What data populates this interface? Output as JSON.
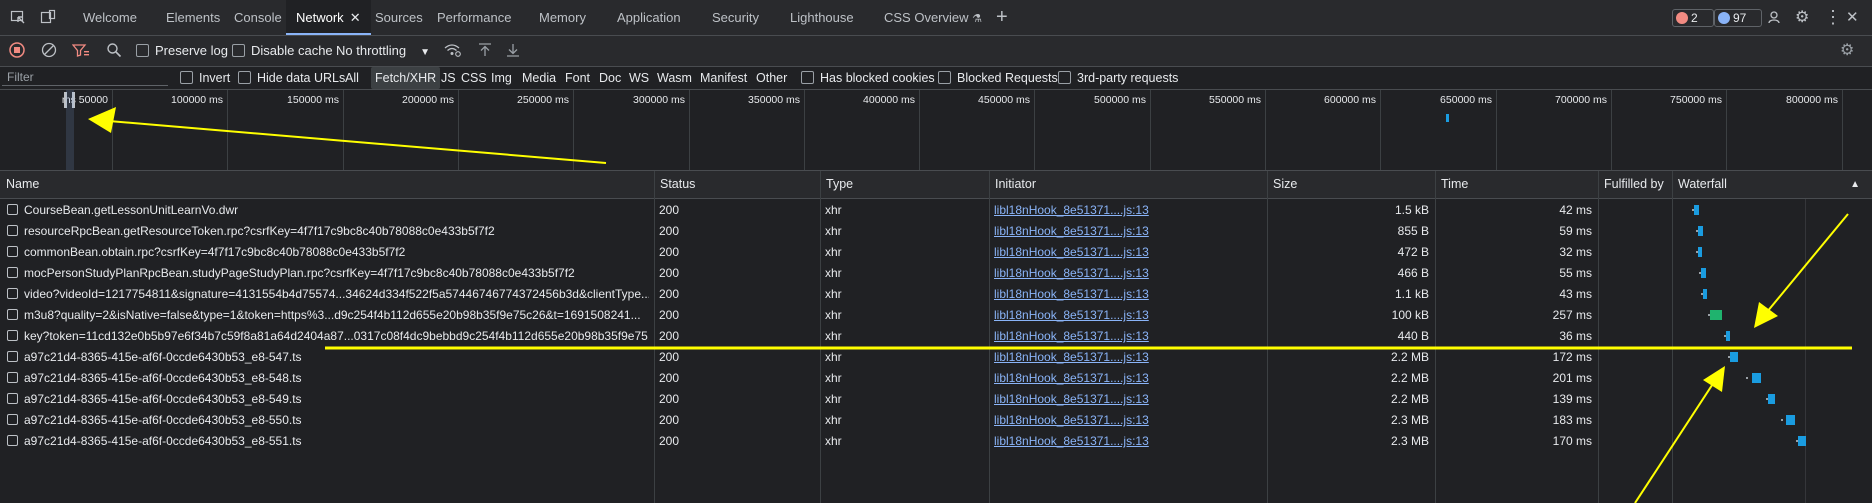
{
  "tabs": {
    "welcome": "Welcome",
    "elements": "Elements",
    "console": "Console",
    "network": "Network",
    "sources": "Sources",
    "performance": "Performance",
    "memory": "Memory",
    "application": "Application",
    "security": "Security",
    "lighthouse": "Lighthouse",
    "css_overview": "CSS Overview"
  },
  "status_counts": {
    "errors": "2",
    "messages": "97"
  },
  "toolbar": {
    "preserve_log": "Preserve log",
    "disable_cache": "Disable cache",
    "throttling": "No throttling"
  },
  "filter": {
    "placeholder": "Filter",
    "invert": "Invert",
    "hide_data_urls": "Hide data URLs",
    "types": [
      "All",
      "Fetch/XHR",
      "JS",
      "CSS",
      "Img",
      "Media",
      "Font",
      "Doc",
      "WS",
      "Wasm",
      "Manifest",
      "Other"
    ],
    "selected_type": "Fetch/XHR",
    "has_blocked_cookies": "Has blocked cookies",
    "blocked_requests": "Blocked Requests",
    "third_party": "3rd-party requests"
  },
  "overview_ticks": [
    "50000 ms",
    "100000 ms",
    "150000 ms",
    "200000 ms",
    "250000 ms",
    "300000 ms",
    "350000 ms",
    "400000 ms",
    "450000 ms",
    "500000 ms",
    "550000 ms",
    "600000 ms",
    "650000 ms",
    "700000 ms",
    "750000 ms",
    "800000 ms"
  ],
  "columns": {
    "name": "Name",
    "status": "Status",
    "type": "Type",
    "initiator": "Initiator",
    "size": "Size",
    "time": "Time",
    "fulfilled_by": "Fulfilled by",
    "waterfall": "Waterfall"
  },
  "requests": [
    {
      "name": "CourseBean.getLessonUnitLearnVo.dwr",
      "status": "200",
      "type": "xhr",
      "initiator": "libl18nHook_8e51371....js:13",
      "size": "1.5 kB",
      "time": "42 ms"
    },
    {
      "name": "resourceRpcBean.getResourceToken.rpc?csrfKey=4f7f17c9bc8c40b78088c0e433b5f7f2",
      "status": "200",
      "type": "xhr",
      "initiator": "libl18nHook_8e51371....js:13",
      "size": "855 B",
      "time": "59 ms"
    },
    {
      "name": "commonBean.obtain.rpc?csrfKey=4f7f17c9bc8c40b78088c0e433b5f7f2",
      "status": "200",
      "type": "xhr",
      "initiator": "libl18nHook_8e51371....js:13",
      "size": "472 B",
      "time": "32 ms"
    },
    {
      "name": "mocPersonStudyPlanRpcBean.studyPageStudyPlan.rpc?csrfKey=4f7f17c9bc8c40b78088c0e433b5f7f2",
      "status": "200",
      "type": "xhr",
      "initiator": "libl18nHook_8e51371....js:13",
      "size": "466 B",
      "time": "55 ms"
    },
    {
      "name": "video?videoId=1217754811&signature=4131554b4d75574...34624d334f522f5a57446746774372456b3d&clientType...",
      "status": "200",
      "type": "xhr",
      "initiator": "libl18nHook_8e51371....js:13",
      "size": "1.1 kB",
      "time": "43 ms"
    },
    {
      "name": "m3u8?quality=2&isNative=false&type=1&token=https%3...d9c254f4b112d655e20b98b35f9e75c26&t=1691508241...",
      "status": "200",
      "type": "xhr",
      "initiator": "libl18nHook_8e51371....js:13",
      "size": "100 kB",
      "time": "257 ms"
    },
    {
      "name": "key?token=11cd132e0b5b97e6f34b7c59f8a81a64d2404a87...0317c08f4dc9bebbd9c254f4b112d655e20b98b35f9e75...",
      "status": "200",
      "type": "xhr",
      "initiator": "libl18nHook_8e51371....js:13",
      "size": "440 B",
      "time": "36 ms"
    },
    {
      "name": "a97c21d4-8365-415e-af6f-0ccde6430b53_e8-547.ts",
      "status": "200",
      "type": "xhr",
      "initiator": "libl18nHook_8e51371....js:13",
      "size": "2.2 MB",
      "time": "172 ms"
    },
    {
      "name": "a97c21d4-8365-415e-af6f-0ccde6430b53_e8-548.ts",
      "status": "200",
      "type": "xhr",
      "initiator": "libl18nHook_8e51371....js:13",
      "size": "2.2 MB",
      "time": "201 ms"
    },
    {
      "name": "a97c21d4-8365-415e-af6f-0ccde6430b53_e8-549.ts",
      "status": "200",
      "type": "xhr",
      "initiator": "libl18nHook_8e51371....js:13",
      "size": "2.2 MB",
      "time": "139 ms"
    },
    {
      "name": "a97c21d4-8365-415e-af6f-0ccde6430b53_e8-550.ts",
      "status": "200",
      "type": "xhr",
      "initiator": "libl18nHook_8e51371....js:13",
      "size": "2.3 MB",
      "time": "183 ms"
    },
    {
      "name": "a97c21d4-8365-415e-af6f-0ccde6430b53_e8-551.ts",
      "status": "200",
      "type": "xhr",
      "initiator": "libl18nHook_8e51371....js:13",
      "size": "2.3 MB",
      "time": "170 ms"
    }
  ],
  "colors": {
    "accent": "#8ab4f8",
    "record": "#f28b82",
    "annotation": "#ffff00",
    "waterfall_download": "#1a9ce0",
    "waterfall_waiting": "#1fb36e",
    "waterfall_queue": "#9aa0a6"
  }
}
